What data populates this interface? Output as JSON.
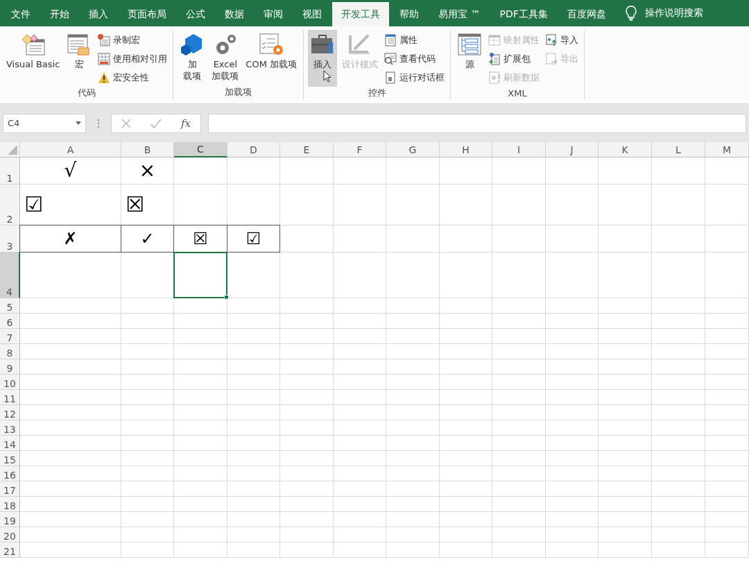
{
  "tabs": [
    {
      "label": "文件",
      "selected": false
    },
    {
      "label": "开始",
      "selected": false
    },
    {
      "label": "插入",
      "selected": false
    },
    {
      "label": "页面布局",
      "selected": false
    },
    {
      "label": "公式",
      "selected": false
    },
    {
      "label": "数据",
      "selected": false
    },
    {
      "label": "审阅",
      "selected": false
    },
    {
      "label": "视图",
      "selected": false
    },
    {
      "label": "开发工具",
      "selected": true
    },
    {
      "label": "帮助",
      "selected": false
    },
    {
      "label": "易用宝 ™",
      "selected": false
    },
    {
      "label": "PDF工具集",
      "selected": false
    },
    {
      "label": "百度网盘",
      "selected": false
    }
  ],
  "search": {
    "label": "操作说明搜索"
  },
  "ribbon": {
    "groups": [
      {
        "label": "代码",
        "large_buttons": [
          {
            "label": [
              "Visual Basic"
            ],
            "pressed": false,
            "disabled": false
          },
          {
            "label": [
              "宏"
            ],
            "pressed": false,
            "disabled": false
          }
        ],
        "small_columns": [
          [
            {
              "label": "录制宏",
              "disabled": false
            },
            {
              "label": "使用相对引用",
              "disabled": false
            },
            {
              "label": "宏安全性",
              "disabled": false
            }
          ]
        ]
      },
      {
        "label": "加载项",
        "large_buttons": [
          {
            "label": [
              "加",
              "载项"
            ],
            "pressed": false,
            "disabled": false
          },
          {
            "label": [
              "Excel",
              "加载项"
            ],
            "pressed": false,
            "disabled": false
          },
          {
            "label": [
              "COM 加载项"
            ],
            "pressed": false,
            "disabled": false
          }
        ]
      },
      {
        "label": "控件",
        "large_buttons": [
          {
            "label": [
              "插入"
            ],
            "pressed": true,
            "disabled": false
          },
          {
            "label": [
              "设计模式"
            ],
            "pressed": false,
            "disabled": true
          }
        ],
        "small_columns": [
          [
            {
              "label": "属性",
              "disabled": false
            },
            {
              "label": "查看代码",
              "disabled": false
            },
            {
              "label": "运行对话框",
              "disabled": false
            }
          ]
        ]
      },
      {
        "label": "XML",
        "large_buttons": [
          {
            "label": [
              "源"
            ],
            "pressed": false,
            "disabled": false
          }
        ],
        "small_columns": [
          [
            {
              "label": "映射属性",
              "disabled": true
            },
            {
              "label": "扩展包",
              "disabled": false
            },
            {
              "label": "刷新数据",
              "disabled": true
            }
          ],
          [
            {
              "label": "导入",
              "disabled": false
            },
            {
              "label": "导出",
              "disabled": true
            }
          ]
        ]
      }
    ]
  },
  "formula_bar": {
    "name_box": "C4",
    "function_label": "fx"
  },
  "sheet": {
    "columns": [
      {
        "label": "A",
        "selected": false
      },
      {
        "label": "B",
        "selected": false
      },
      {
        "label": "C",
        "selected": true
      },
      {
        "label": "D",
        "selected": false
      },
      {
        "label": "E",
        "selected": false
      },
      {
        "label": "F",
        "selected": false
      },
      {
        "label": "G",
        "selected": false
      },
      {
        "label": "H",
        "selected": false
      },
      {
        "label": "I",
        "selected": false
      },
      {
        "label": "J",
        "selected": false
      },
      {
        "label": "K",
        "selected": false
      },
      {
        "label": "L",
        "selected": false
      },
      {
        "label": "M",
        "selected": false
      }
    ],
    "rows": [
      {
        "label": "1",
        "selected": false,
        "cells": [
          {
            "text": "√",
            "bordered": false,
            "selected": false
          },
          {
            "text": "×",
            "bordered": false,
            "selected": false
          },
          {
            "bordered": false,
            "selected": false
          },
          {
            "bordered": false,
            "selected": false
          }
        ]
      },
      {
        "label": "2",
        "selected": false,
        "cells": [
          {
            "text": "☑",
            "bordered": false,
            "selected": false
          },
          {
            "text": "☒",
            "bordered": false,
            "selected": false
          },
          {
            "bordered": false,
            "selected": false
          },
          {
            "bordered": false,
            "selected": false
          }
        ]
      },
      {
        "label": "3",
        "selected": false,
        "cells": [
          {
            "text": "✗",
            "bordered": true,
            "selected": false
          },
          {
            "text": "✓",
            "bordered": true,
            "selected": false
          },
          {
            "text": "☒",
            "bordered": true,
            "selected": false
          },
          {
            "text": "☑",
            "bordered": true,
            "selected": false
          }
        ]
      },
      {
        "label": "4",
        "selected": true,
        "cells": [
          {
            "bordered": false,
            "selected": false
          },
          {
            "bordered": false,
            "selected": false
          },
          {
            "bordered": false,
            "selected": true
          },
          {
            "bordered": false,
            "selected": false
          }
        ]
      },
      {
        "label": "5",
        "selected": false
      },
      {
        "label": "6",
        "selected": false
      },
      {
        "label": "7",
        "selected": false
      },
      {
        "label": "8",
        "selected": false
      },
      {
        "label": "9",
        "selected": false
      },
      {
        "label": "10",
        "selected": false
      },
      {
        "label": "11",
        "selected": false
      },
      {
        "label": "12",
        "selected": false
      },
      {
        "label": "13",
        "selected": false
      },
      {
        "label": "14",
        "selected": false
      },
      {
        "label": "15",
        "selected": false
      },
      {
        "label": "16",
        "selected": false
      },
      {
        "label": "17",
        "selected": false
      },
      {
        "label": "18",
        "selected": false
      },
      {
        "label": "19",
        "selected": false
      },
      {
        "label": "20",
        "selected": false
      },
      {
        "label": "21",
        "selected": false
      }
    ]
  }
}
